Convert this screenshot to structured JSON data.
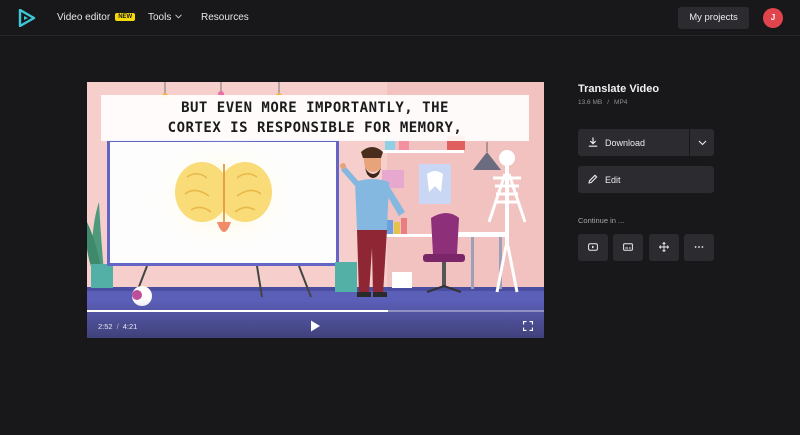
{
  "header": {
    "nav": {
      "video_editor": "Video editor",
      "new_badge": "NEW",
      "tools": "Tools",
      "resources": "Resources"
    },
    "my_projects": "My projects",
    "avatar_initial": "J"
  },
  "player": {
    "caption_line1": "BUT EVEN MORE IMPORTANTLY, THE",
    "caption_line2": "CORTEX IS RESPONSIBLE FOR MEMORY,",
    "current_time": "2:52",
    "time_separator": "/",
    "duration": "4:21",
    "progress": 0.659,
    "icons": {
      "play": "play-icon",
      "fullscreen": "fullscreen-icon"
    }
  },
  "file": {
    "title": "Translate Video",
    "size": "13.6 MB",
    "meta_separator": "/",
    "format": "MP4"
  },
  "actions": {
    "download_label": "Download",
    "edit_label": "Edit",
    "continue_label": "Continue in ..."
  },
  "continue_icons": [
    "youtube-icon",
    "subtitles-icon",
    "sparkle-move-icon",
    "more-icon"
  ],
  "colors": {
    "background": "#18181b",
    "button": "#2c2c30",
    "badge": "#f5d90a",
    "avatar": "#e0444d",
    "logo": "#3ec7d6"
  }
}
